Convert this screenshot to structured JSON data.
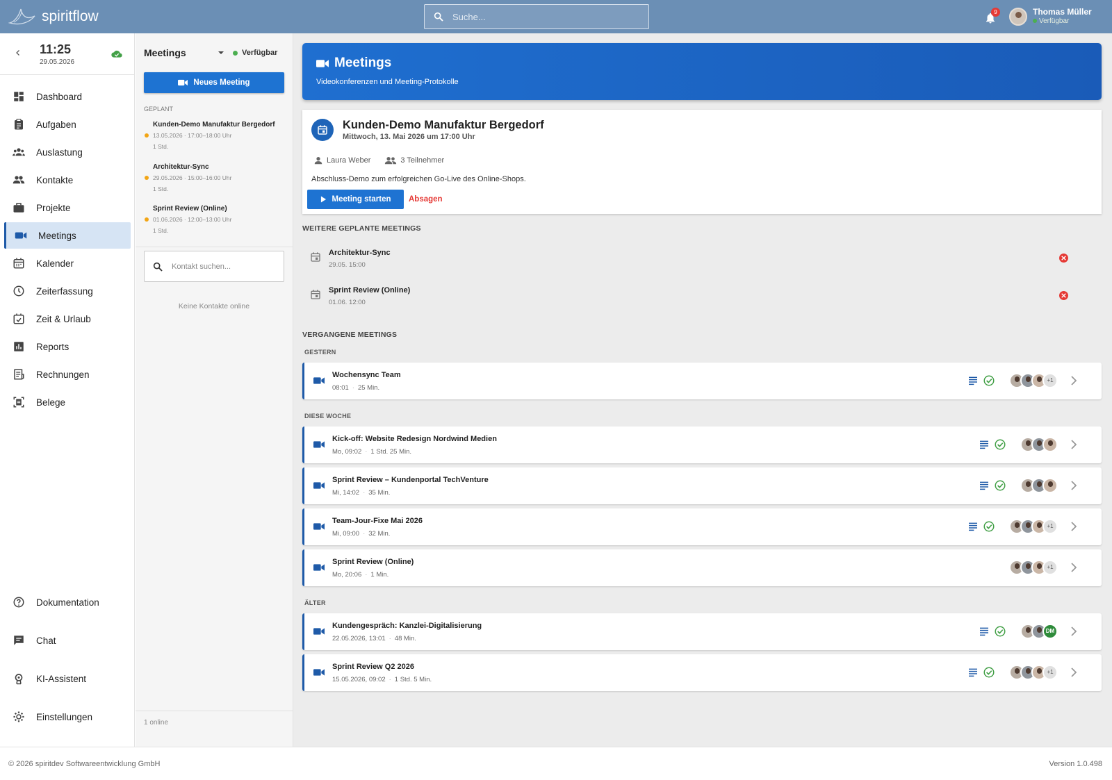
{
  "app": {
    "name": "spiritflow"
  },
  "header": {
    "search_placeholder": "Suche...",
    "notification_count": "9",
    "user_name": "Thomas Müller",
    "user_status": "Verfügbar"
  },
  "sidebar": {
    "time": "11:25",
    "date": "29.05.2026",
    "items": [
      {
        "label": "Dashboard",
        "icon": "dashboard-icon"
      },
      {
        "label": "Aufgaben",
        "icon": "clipboard-icon"
      },
      {
        "label": "Auslastung",
        "icon": "group-icon"
      },
      {
        "label": "Kontakte",
        "icon": "people-icon"
      },
      {
        "label": "Projekte",
        "icon": "briefcase-icon"
      },
      {
        "label": "Meetings",
        "icon": "video-icon",
        "active": true
      },
      {
        "label": "Kalender",
        "icon": "calendar-icon"
      },
      {
        "label": "Zeiterfassung",
        "icon": "clock-icon"
      },
      {
        "label": "Zeit & Urlaub",
        "icon": "calendar-check-icon"
      },
      {
        "label": "Reports",
        "icon": "bar-chart-icon"
      },
      {
        "label": "Rechnungen",
        "icon": "receipt-icon"
      },
      {
        "label": "Belege",
        "icon": "document-scan-icon"
      }
    ],
    "bottom_items": [
      {
        "label": "Dokumentation",
        "icon": "help-icon"
      },
      {
        "label": "Chat",
        "icon": "chat-icon"
      },
      {
        "label": "KI-Assistent",
        "icon": "ai-assistant-icon"
      },
      {
        "label": "Einstellungen",
        "icon": "gear-icon"
      }
    ]
  },
  "midpanel": {
    "title": "Meetings",
    "status": "Verfügbar",
    "new_meeting_label": "Neues Meeting",
    "planned_heading": "GEPLANT",
    "planned": [
      {
        "title": "Kunden-Demo Manufaktur Bergedorf",
        "date": "13.05.2026 · 17:00–18:00 Uhr",
        "duration": "1 Std."
      },
      {
        "title": "Architektur-Sync",
        "date": "29.05.2026 · 15:00–16:00 Uhr",
        "duration": "1 Std."
      },
      {
        "title": "Sprint Review (Online)",
        "date": "01.06.2026 · 12:00–13:00 Uhr",
        "duration": "1 Std."
      }
    ],
    "contact_search_placeholder": "Kontakt suchen...",
    "no_contacts": "Keine Kontakte online",
    "online_count": "1 online"
  },
  "hero": {
    "title": "Meetings",
    "subtitle": "Videokonferenzen und Meeting-Protokolle"
  },
  "next_meeting": {
    "title": "Kunden-Demo Manufaktur Bergedorf",
    "when": "Mittwoch, 13. Mai 2026 um 17:00 Uhr",
    "organizer": "Laura Weber",
    "participants": "3 Teilnehmer",
    "description": "Abschluss-Demo zum erfolgreichen Go-Live des Online-Shops.",
    "start_label": "Meeting starten",
    "cancel_label": "Absagen"
  },
  "upcoming": {
    "heading": "WEITERE GEPLANTE MEETINGS",
    "items": [
      {
        "title": "Architektur-Sync",
        "date": "29.05. 15:00"
      },
      {
        "title": "Sprint Review (Online)",
        "date": "01.06. 12:00"
      }
    ]
  },
  "past": {
    "heading": "VERGANGENE MEETINGS",
    "groups": [
      {
        "label": "GESTERN",
        "items": [
          {
            "title": "Wochensync Team",
            "time": "08:01",
            "duration": "25 Min.",
            "protocol": true,
            "avatars": [
              "a",
              "b",
              "c"
            ],
            "extra": "+1"
          }
        ]
      },
      {
        "label": "DIESE WOCHE",
        "items": [
          {
            "title": "Kick-off: Website Redesign Nordwind Medien",
            "time": "Mo, 09:02",
            "duration": "1 Std. 25 Min.",
            "protocol": true,
            "avatars": [
              "a",
              "b",
              "c"
            ],
            "extra": ""
          },
          {
            "title": "Sprint Review – Kundenportal TechVenture",
            "time": "Mi, 14:02",
            "duration": "35 Min.",
            "protocol": true,
            "avatars": [
              "a",
              "b",
              "c"
            ],
            "extra": ""
          },
          {
            "title": "Team-Jour-Fixe Mai 2026",
            "time": "Mi, 09:00",
            "duration": "32 Min.",
            "protocol": true,
            "avatars": [
              "a",
              "b",
              "c"
            ],
            "extra": "+1"
          },
          {
            "title": "Sprint Review (Online)",
            "time": "Mo, 20:06",
            "duration": "1 Min.",
            "protocol": false,
            "avatars": [
              "a",
              "b",
              "c"
            ],
            "extra": "+1"
          }
        ]
      },
      {
        "label": "ÄLTER",
        "items": [
          {
            "title": "Kundengespräch: Kanzlei-Digitalisierung",
            "time": "22.05.2026, 13:01",
            "duration": "48 Min.",
            "protocol": true,
            "avatars": [
              "a",
              "b"
            ],
            "extra": "DM"
          },
          {
            "title": "Sprint Review Q2 2026",
            "time": "15.05.2026, 09:02",
            "duration": "1 Std. 5 Min.",
            "protocol": true,
            "avatars": [
              "a",
              "b",
              "c"
            ],
            "extra": "+1"
          }
        ]
      }
    ]
  },
  "footer": {
    "copyright": "© 2026 spiritdev Softwareentwicklung GmbH",
    "version": "Version 1.0.498"
  },
  "colors": {
    "header": "#6b8fb5",
    "primary": "#1e73d2",
    "danger": "#e53935",
    "success": "#43a047"
  }
}
